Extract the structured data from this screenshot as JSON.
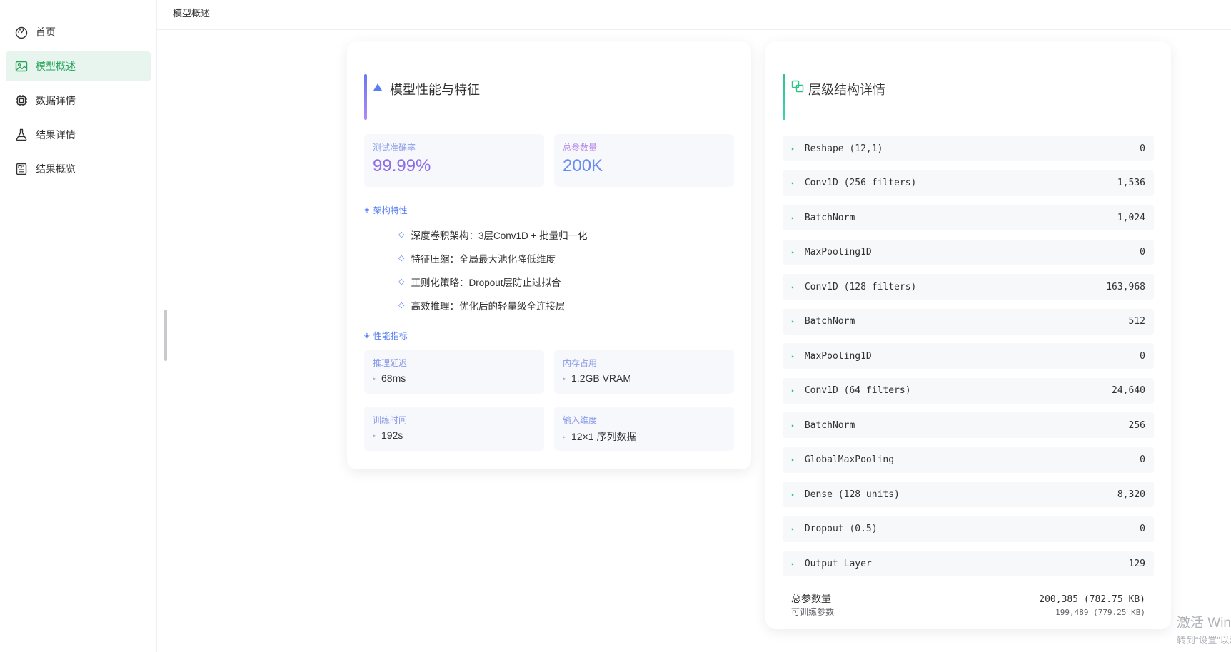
{
  "sidebar": {
    "items": [
      {
        "label": "首页",
        "icon": "dashboard-icon"
      },
      {
        "label": "模型概述",
        "icon": "image-icon",
        "active": true
      },
      {
        "label": "数据详情",
        "icon": "chip-icon"
      },
      {
        "label": "结果详情",
        "icon": "flask-icon"
      },
      {
        "label": "结果概览",
        "icon": "document-icon"
      }
    ]
  },
  "topbar": {
    "breadcrumb": "模型概述"
  },
  "performance": {
    "title": "模型性能与特征",
    "accuracy": {
      "label": "测试准确率",
      "value": "99.99%"
    },
    "params": {
      "label": "总参数量",
      "value": "200K"
    },
    "arch_title": "架构特性",
    "features": [
      "深度卷积架构：3层Conv1D + 批量归一化",
      "特征压缩：全局最大池化降低维度",
      "正则化策略：Dropout层防止过拟合",
      "高效推理：优化后的轻量级全连接层"
    ],
    "metrics_title": "性能指标",
    "metrics": [
      {
        "label": "推理延迟",
        "value": "68ms"
      },
      {
        "label": "内存占用",
        "value": "1.2GB VRAM"
      },
      {
        "label": "训练时间",
        "value": "192s"
      },
      {
        "label": "输入维度",
        "value": "12×1 序列数据"
      }
    ]
  },
  "layers": {
    "title": "层级结构详情",
    "rows": [
      {
        "name": "Reshape (12,1)",
        "params": "0"
      },
      {
        "name": "Conv1D (256 filters)",
        "params": "1,536"
      },
      {
        "name": "BatchNorm",
        "params": "1,024"
      },
      {
        "name": "MaxPooling1D",
        "params": "0"
      },
      {
        "name": "Conv1D (128 filters)",
        "params": "163,968"
      },
      {
        "name": "BatchNorm",
        "params": "512"
      },
      {
        "name": "MaxPooling1D",
        "params": "0"
      },
      {
        "name": "Conv1D (64 filters)",
        "params": "24,640"
      },
      {
        "name": "BatchNorm",
        "params": "256"
      },
      {
        "name": "GlobalMaxPooling",
        "params": "0"
      },
      {
        "name": "Dense (128 units)",
        "params": "8,320"
      },
      {
        "name": "Dropout (0.5)",
        "params": "0"
      },
      {
        "name": "Output Layer",
        "params": "129"
      }
    ],
    "total_label": "总参数量",
    "total_value": "200,385 (782.75 KB)",
    "trainable_label": "可训练参数",
    "trainable_value": "199,489 (779.25 KB)"
  },
  "watermark": {
    "line1": "激活 Wind",
    "line2": "转到“设置”以激"
  },
  "colors": {
    "accent_green": "#23a55a",
    "accent_blue": "#5b7ff2",
    "accent_purple": "#8c6ce8"
  }
}
